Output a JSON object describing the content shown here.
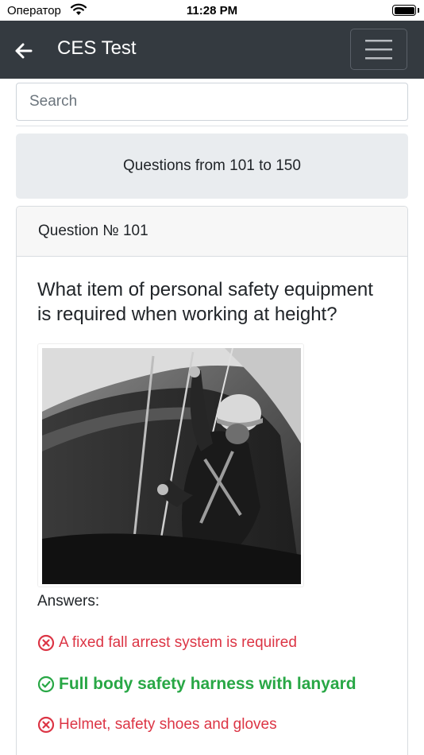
{
  "status_bar": {
    "carrier": "Оператор",
    "time": "11:28 PM"
  },
  "navbar": {
    "title": "CES Test"
  },
  "search": {
    "placeholder": "Search"
  },
  "range_banner": {
    "text": "Questions from 101 to 150"
  },
  "question": {
    "header": "Question № 101",
    "text": "What item of personal safety equipment is required when working at height?",
    "answers_label": "Answers:",
    "answers": [
      {
        "text": "A fixed fall arrest system is required",
        "correct": false
      },
      {
        "text": "Full body safety harness with lanyard",
        "correct": true
      },
      {
        "text": "Helmet, safety shoes and gloves",
        "correct": false
      }
    ]
  },
  "colors": {
    "navbar": "#343a40",
    "correct": "#28a745",
    "wrong": "#dc3545",
    "banner": "#e9ecef"
  }
}
